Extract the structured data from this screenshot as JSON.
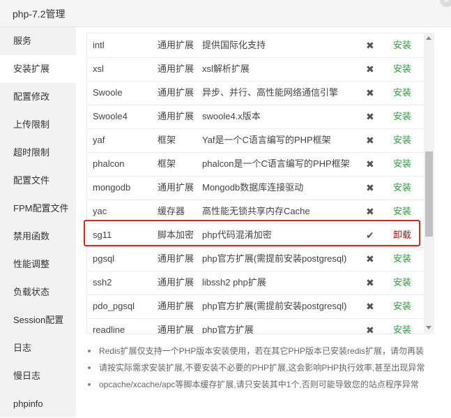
{
  "window": {
    "title": "php-7.2管理",
    "close_label": "✕"
  },
  "sidebar": {
    "items": [
      {
        "label": "服务"
      },
      {
        "label": "安装扩展"
      },
      {
        "label": "配置修改"
      },
      {
        "label": "上传限制"
      },
      {
        "label": "超时限制"
      },
      {
        "label": "配置文件"
      },
      {
        "label": "FPM配置文件"
      },
      {
        "label": "禁用函数"
      },
      {
        "label": "性能调整"
      },
      {
        "label": "负载状态"
      },
      {
        "label": "Session配置"
      },
      {
        "label": "日志"
      },
      {
        "label": "慢日志"
      },
      {
        "label": "phpinfo"
      }
    ],
    "active_index": 1
  },
  "extensions": [
    {
      "name": "intl",
      "type": "通用扩展",
      "desc": "提供国际化支持",
      "status": "✖",
      "action": "安装"
    },
    {
      "name": "xsl",
      "type": "通用扩展",
      "desc": "xsl解析扩展",
      "status": "✖",
      "action": "安装"
    },
    {
      "name": "Swoole",
      "type": "通用扩展",
      "desc": "异步、并行、高性能网络通信引擎",
      "status": "✖",
      "action": "安装"
    },
    {
      "name": "Swoole4",
      "type": "通用扩展",
      "desc": "swoole4.x版本",
      "status": "✖",
      "action": "安装"
    },
    {
      "name": "yaf",
      "type": "框架",
      "desc": "Yaf是一个C语言编写的PHP框架",
      "status": "✖",
      "action": "安装"
    },
    {
      "name": "phalcon",
      "type": "框架",
      "desc": "phalcon是一个C语言编写的PHP框架",
      "status": "✖",
      "action": "安装"
    },
    {
      "name": "mongodb",
      "type": "通用扩展",
      "desc": "Mongodb数据库连接驱动",
      "status": "✖",
      "action": "安装"
    },
    {
      "name": "yac",
      "type": "缓存器",
      "desc": "高性能无锁共享内存Cache",
      "status": "✖",
      "action": "安装"
    },
    {
      "name": "sg11",
      "type": "脚本加密",
      "desc": "php代码混淆加密",
      "status": "✔",
      "action": "卸载"
    },
    {
      "name": "pgsql",
      "type": "通用扩展",
      "desc": "php官方扩展(需提前安装postgresql)",
      "status": "✖",
      "action": "安装"
    },
    {
      "name": "ssh2",
      "type": "通用扩展",
      "desc": "libssh2 php扩展",
      "status": "✖",
      "action": "安装"
    },
    {
      "name": "pdo_pgsql",
      "type": "通用扩展",
      "desc": "php官方扩展(需提前安装postgresql)",
      "status": "✖",
      "action": "安装"
    },
    {
      "name": "readline",
      "type": "通用扩展",
      "desc": "php官方扩展",
      "status": "✖",
      "action": "安装"
    }
  ],
  "notes": [
    "Redis扩展仅支持一个PHP版本安装使用，若在其它PHP版本已安装redis扩展，请勿再装",
    "请按实际需求安装扩展,不要安装不必要的PHP扩展,这会影响PHP执行效率,甚至出现异常",
    "opcache/xcache/apc等脚本缓存扩展,请只安装其中1个,否则可能导致您的站点程序异常"
  ],
  "colors": {
    "install": "#20a53a",
    "uninstall": "#cc0000",
    "highlight": "#e2231a"
  }
}
